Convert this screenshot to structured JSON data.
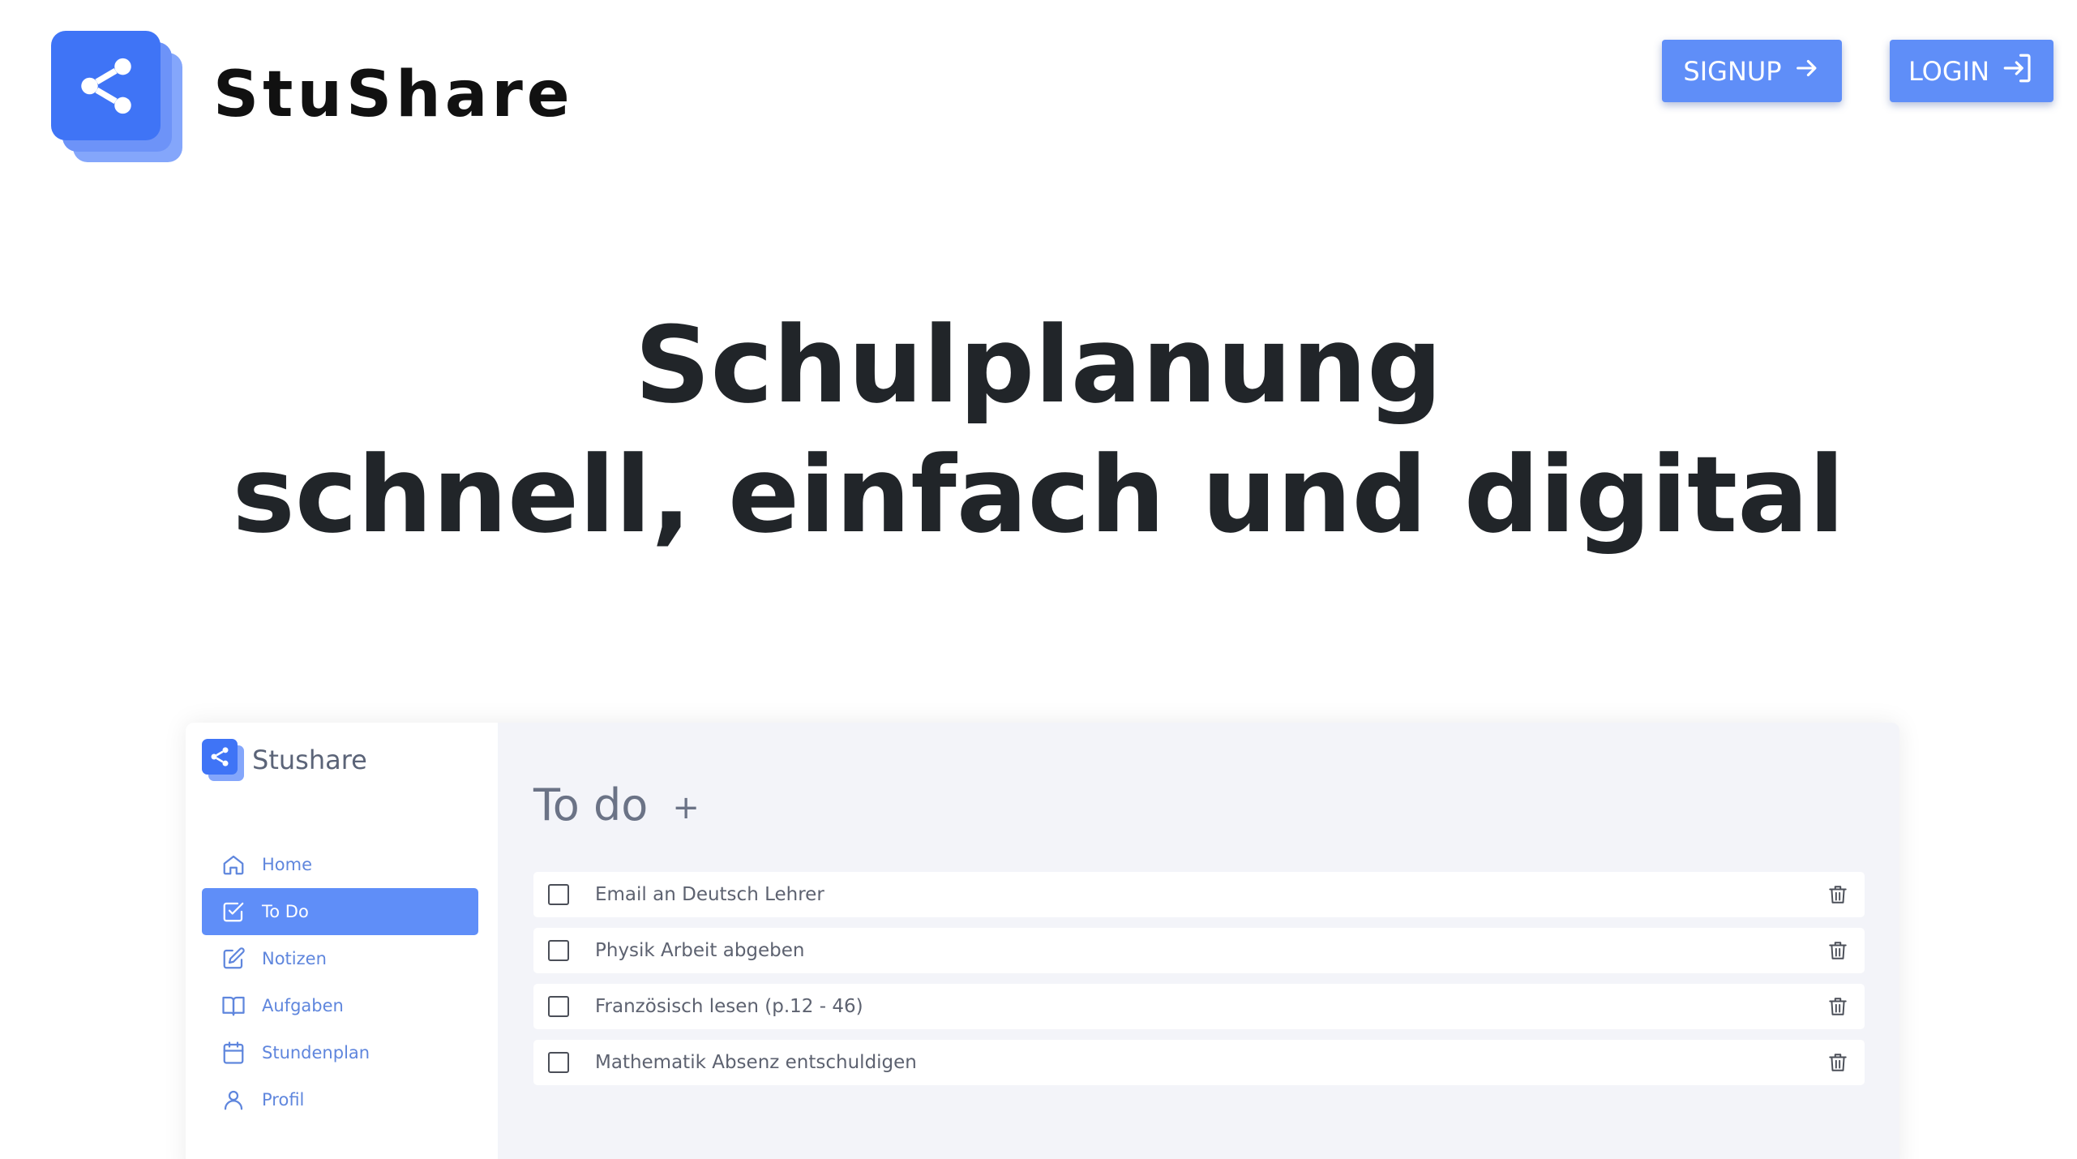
{
  "header": {
    "brand_name": "StuShare",
    "signup_label": "SIGNUP",
    "login_label": "LOGIN"
  },
  "hero": {
    "line1": "Schulplanung",
    "line2": "schnell, einfach und digital"
  },
  "preview": {
    "brand_name": "Stushare",
    "nav": [
      {
        "label": "Home",
        "icon": "home-icon"
      },
      {
        "label": "To Do",
        "icon": "checkbox-icon",
        "active": true
      },
      {
        "label": "Notizen",
        "icon": "edit-icon"
      },
      {
        "label": "Aufgaben",
        "icon": "book-icon"
      },
      {
        "label": "Stundenplan",
        "icon": "calendar-icon"
      },
      {
        "label": "Profil",
        "icon": "user-icon"
      }
    ],
    "todo_title": "To do",
    "add_symbol": "+",
    "todos": [
      {
        "text": "Email an Deutsch Lehrer",
        "done": false
      },
      {
        "text": "Physik Arbeit abgeben",
        "done": false
      },
      {
        "text": "Französisch lesen (p.12 - 46)",
        "done": false
      },
      {
        "text": "Mathematik Absenz entschuldigen",
        "done": false
      }
    ]
  },
  "colors": {
    "accent": "#5f8ef8",
    "logo_blue": "#3f74f6",
    "nav_text": "#5f86dd",
    "preview_bg": "#f3f4f9"
  }
}
